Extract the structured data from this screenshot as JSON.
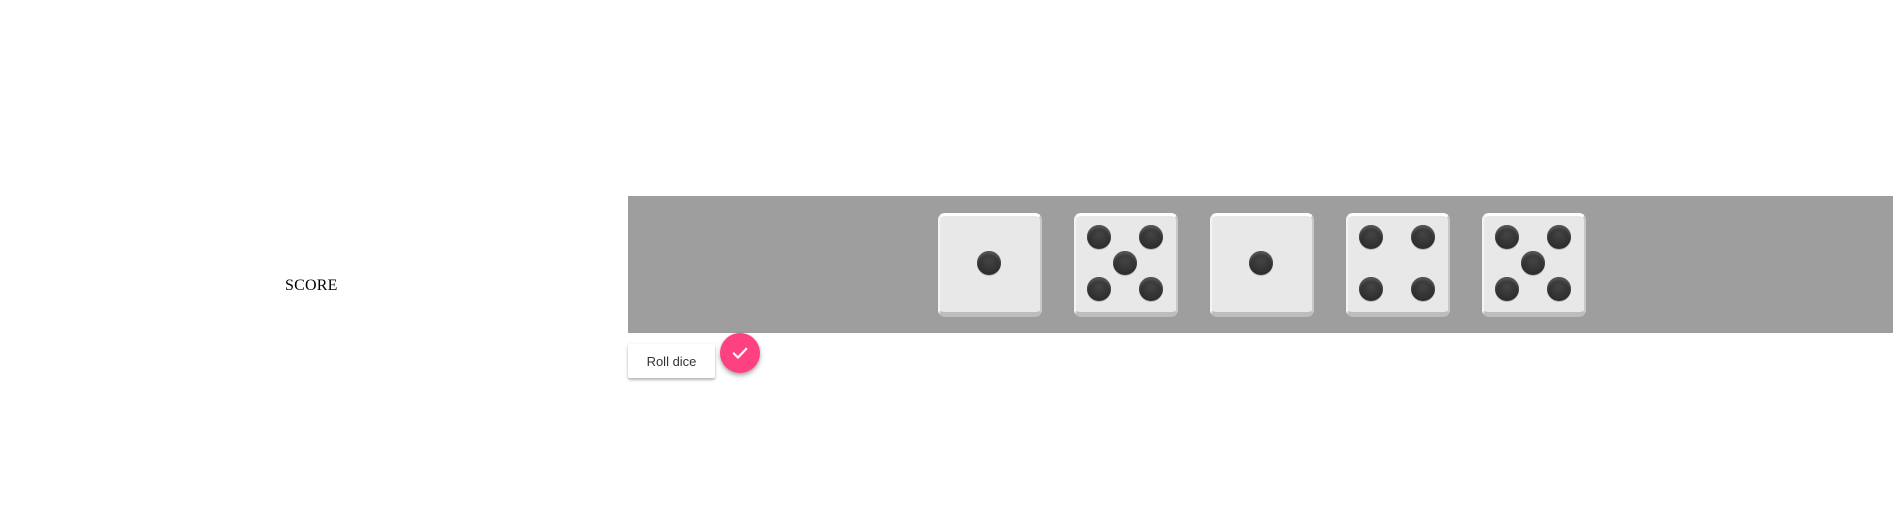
{
  "score": {
    "label": "SCORE"
  },
  "dice": [
    {
      "value": 1
    },
    {
      "value": 5
    },
    {
      "value": 1
    },
    {
      "value": 4
    },
    {
      "value": 5
    }
  ],
  "controls": {
    "roll_label": "Roll dice",
    "confirm_icon": "check-icon"
  },
  "colors": {
    "tray": "#9e9e9e",
    "die_face": "#e8e8e8",
    "pip": "#333333",
    "accent": "#ff4081"
  }
}
